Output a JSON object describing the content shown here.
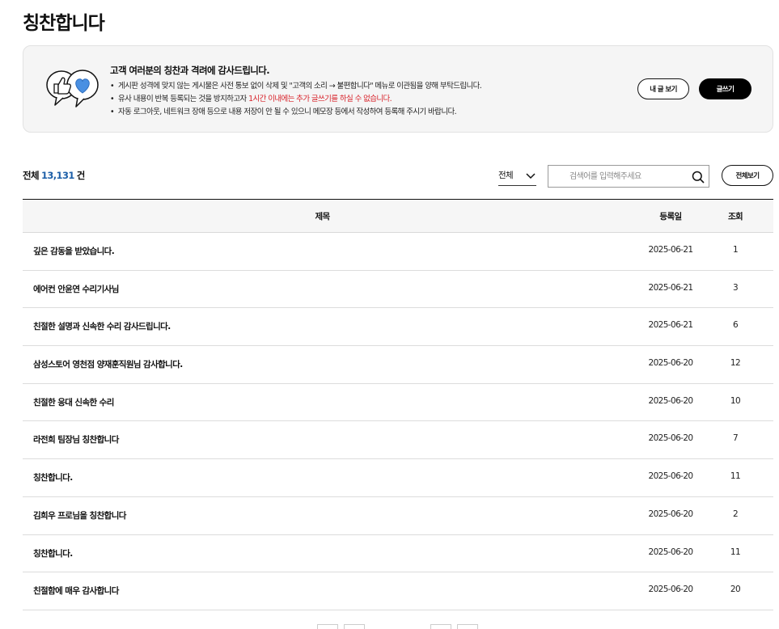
{
  "page": {
    "title": "칭찬합니다"
  },
  "notice": {
    "heading": "고객 여러분의 칭찬과 격려에 감사드립니다.",
    "bullet": "•",
    "line1": "게시판 성격에 맞지 않는 게시물은 사전 통보 없이 삭제 및 \"고객의 소리 → 불편합니다\" 메뉴로 이관됨을 양해 부탁드립니다.",
    "line2_prefix": "유사 내용이 반복 등록되는 것을 방지하고자 ",
    "line2_highlight": "1시간 이내에는 추가 글쓰기를 하실 수 없습니다.",
    "line3": "자동 로그아웃, 네트워크 장애 등으로 내용 저장이 안 될 수 있으니 메모장 등에서 작성하여 등록해 주시기 바랍니다.",
    "icon": "thumbs-up-heart-chat-icon",
    "accent_color": "#4a90e2"
  },
  "actions": {
    "my_posts_label": "내 글 보기",
    "write_label": "글쓰기"
  },
  "summary": {
    "prefix": "전체",
    "count": "13,131",
    "suffix": "건",
    "count_color": "#1d5fa8"
  },
  "filter": {
    "selected": "전체"
  },
  "search": {
    "placeholder": "검색어를 입력해주세요",
    "view_all_label": "전체보기"
  },
  "table": {
    "headers": {
      "title": "제목",
      "date": "등록일",
      "views": "조회"
    },
    "rows": [
      {
        "title": "깊은 감동을 받았습니다.",
        "date": "2025-06-21",
        "views": "1"
      },
      {
        "title": "에어컨 안윤연 수리기사님",
        "date": "2025-06-21",
        "views": "3"
      },
      {
        "title": "친절한 설명과 신속한 수리 감사드립니다.",
        "date": "2025-06-21",
        "views": "6"
      },
      {
        "title": "삼성스토어 영천점 양재훈직원님 감사합니다.",
        "date": "2025-06-20",
        "views": "12"
      },
      {
        "title": "친절한 응대 신속한 수리",
        "date": "2025-06-20",
        "views": "10"
      },
      {
        "title": "라전희 팀장님 칭찬합니다",
        "date": "2025-06-20",
        "views": "7"
      },
      {
        "title": "칭찬합니다.",
        "date": "2025-06-20",
        "views": "11"
      },
      {
        "title": "김희우 프로님을 칭찬합니다",
        "date": "2025-06-20",
        "views": "2"
      },
      {
        "title": "칭찬합니다.",
        "date": "2025-06-20",
        "views": "11"
      },
      {
        "title": "친절함에 매우 감사합니다",
        "date": "2025-06-20",
        "views": "20"
      }
    ]
  }
}
